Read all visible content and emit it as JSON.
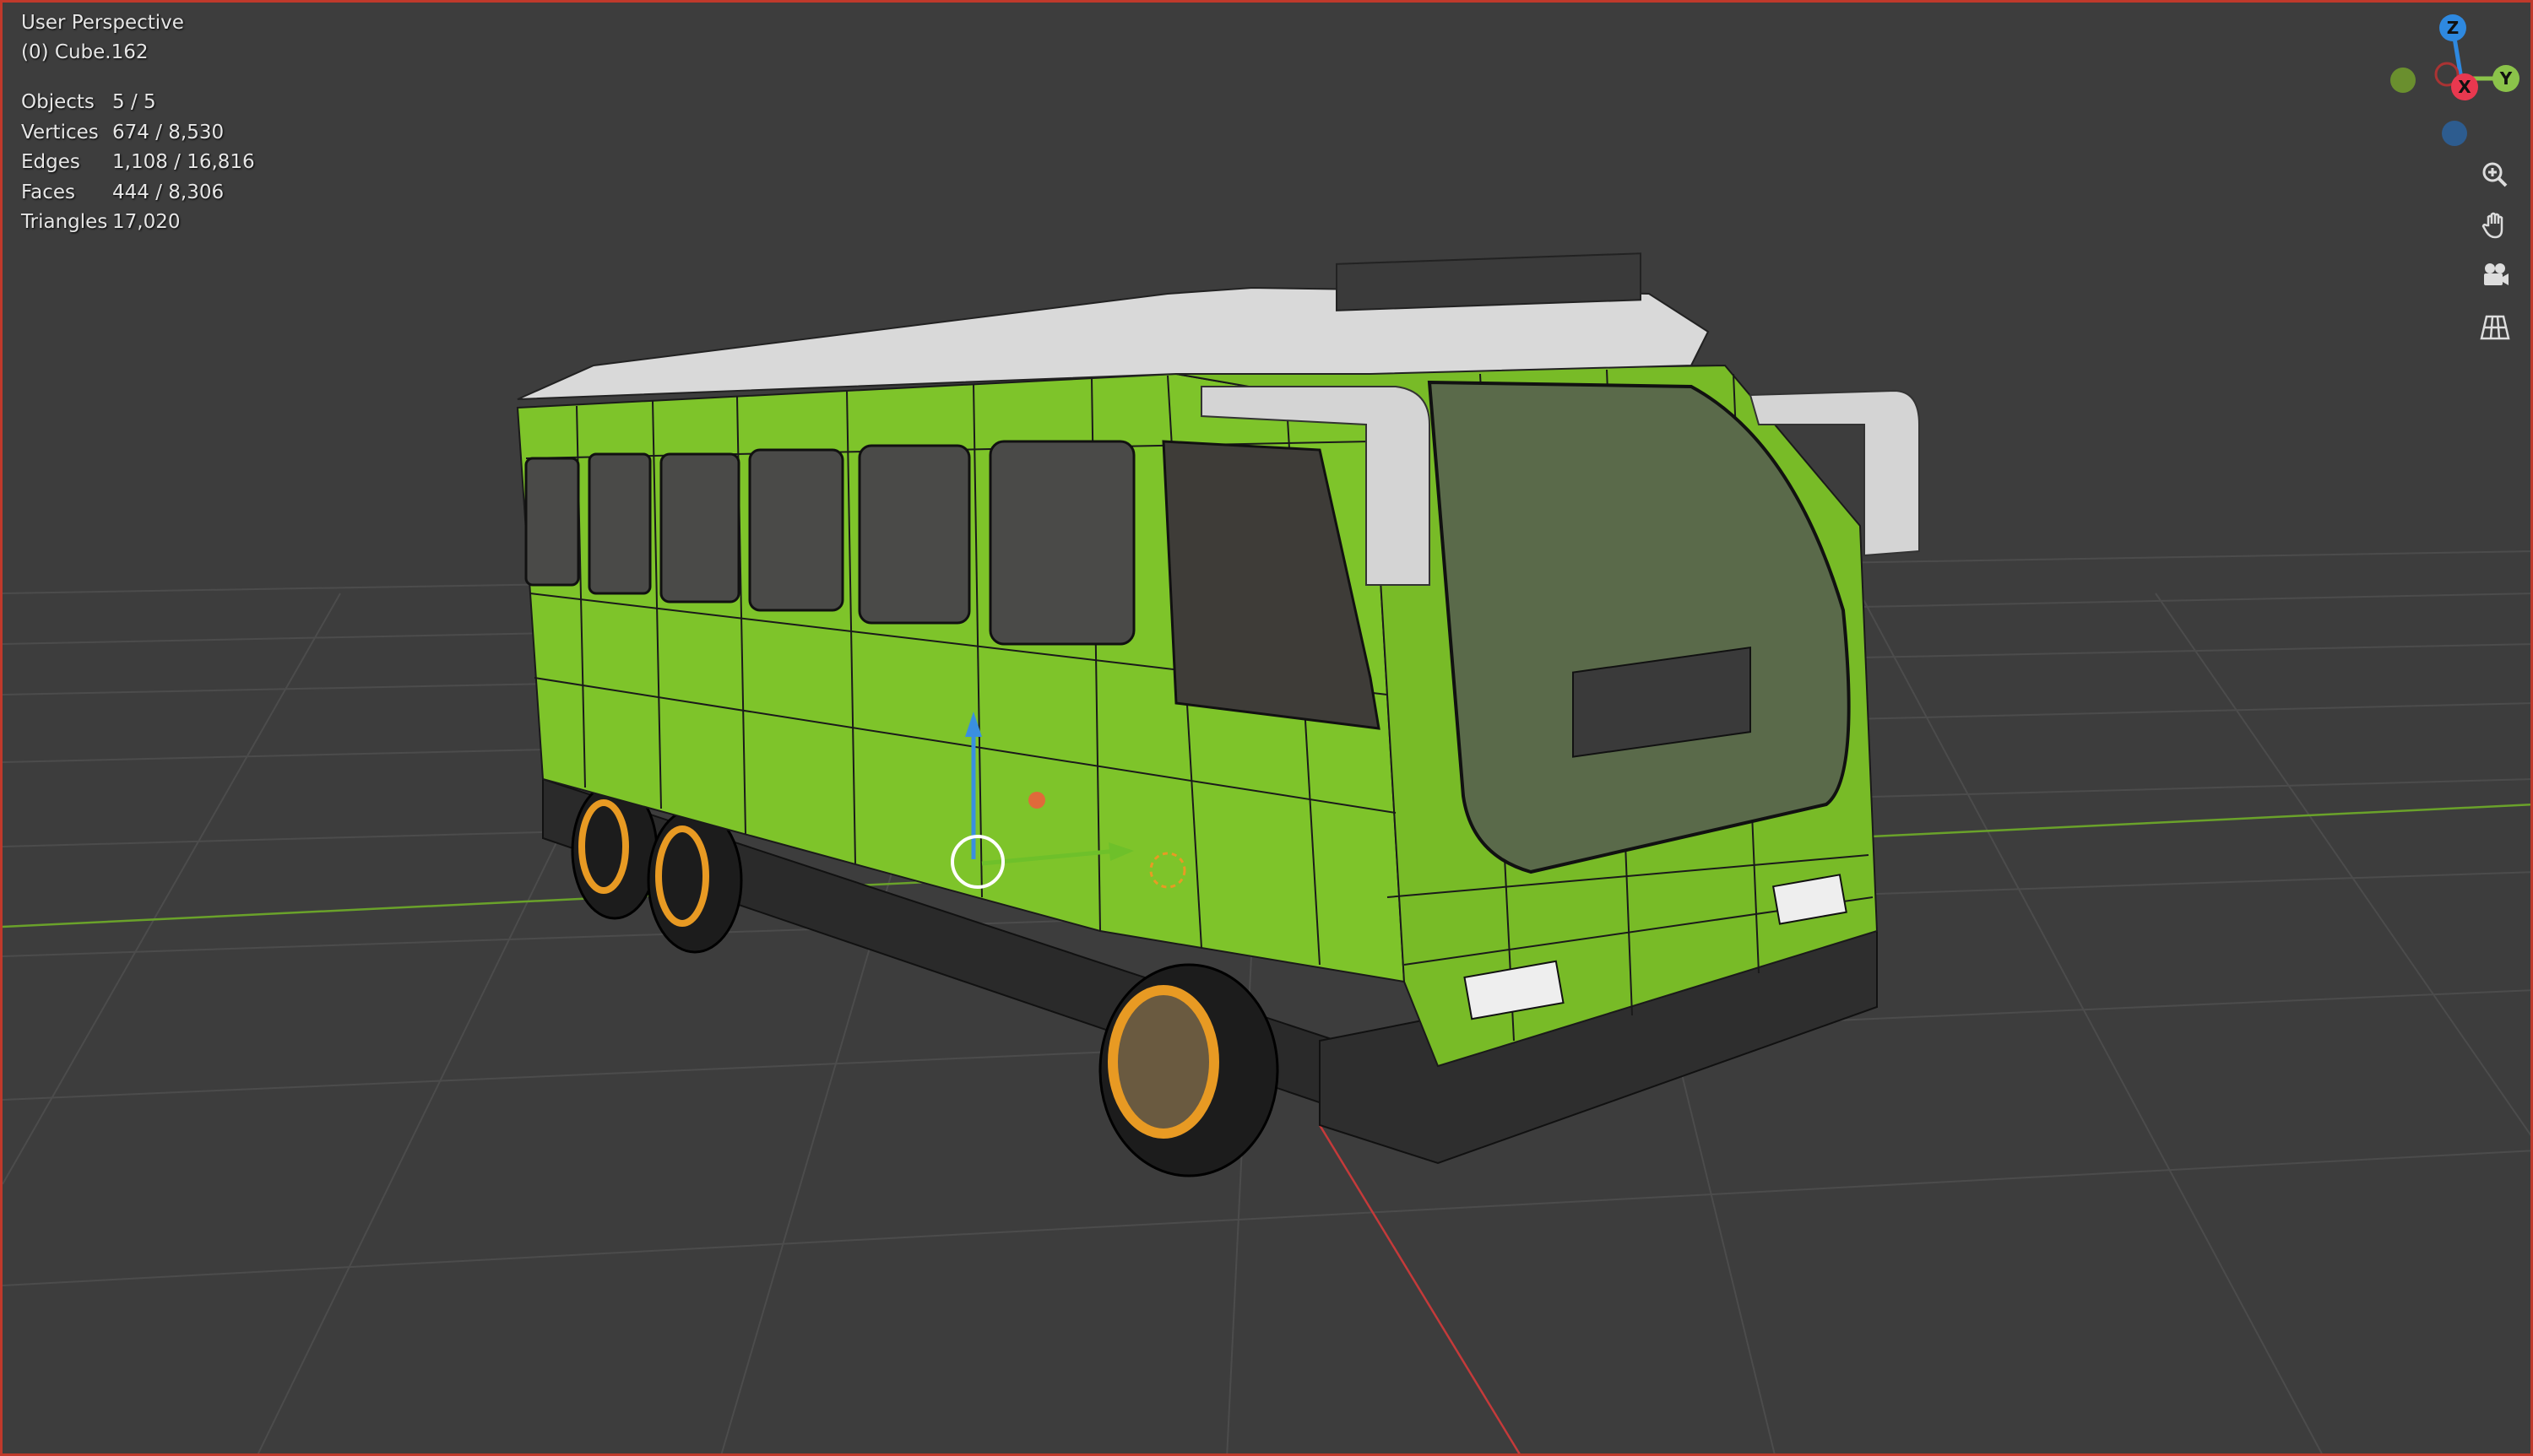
{
  "viewport": {
    "view_name": "User Perspective",
    "active_object": "(0) Cube.162"
  },
  "stats": [
    {
      "label": "Objects",
      "value": "5 / 5"
    },
    {
      "label": "Vertices",
      "value": "674 / 8,530"
    },
    {
      "label": "Edges",
      "value": "1,108 / 16,816"
    },
    {
      "label": "Faces",
      "value": "444 / 8,306"
    },
    {
      "label": "Triangles",
      "value": "17,020"
    }
  ],
  "gizmo": {
    "z_label": "Z",
    "y_label": "Y",
    "x_label": "X",
    "colors": {
      "x": "#e8384f",
      "y": "#8bc34a",
      "z": "#2e89e0",
      "neg_y": "#6a8f2e",
      "neg_z": "#2d5c8f"
    }
  },
  "nav_buttons": [
    {
      "name": "zoom-icon"
    },
    {
      "name": "hand-pan-icon"
    },
    {
      "name": "camera-icon"
    },
    {
      "name": "grid-ortho-icon"
    }
  ],
  "colors": {
    "background": "#3d3d3d",
    "grid": "#4d4d4d",
    "bus_body": "#7ec42a",
    "roof": "#d9d9d9",
    "wheel_rim": "#e89a23",
    "x_axis": "#c43a3a",
    "y_axis": "#6aa22a"
  }
}
